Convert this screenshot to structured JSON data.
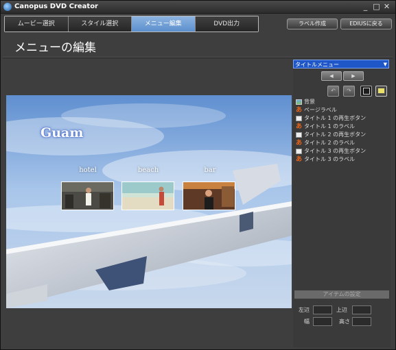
{
  "window": {
    "title": "Canopus DVD Creator",
    "controls": [
      "_",
      "□",
      "✕"
    ]
  },
  "steps": [
    "ムービー選択",
    "スタイル選択",
    "メニュー編集",
    "DVD出力"
  ],
  "active_step": 2,
  "toolbar": {
    "label_create": "ラベル作成",
    "back_to_edius": "EDIUSに戻る"
  },
  "page_title": "メニューの編集",
  "preview": {
    "menu_title": "Guam",
    "thumbnails": [
      {
        "label": "hotel"
      },
      {
        "label": "beach"
      },
      {
        "label": "bar"
      }
    ]
  },
  "panel": {
    "menu_select": "タイトルメニュー",
    "items": [
      {
        "icon": "background-icon",
        "label": "背景"
      },
      {
        "icon": "label-icon",
        "label": "ページラベル"
      },
      {
        "icon": "button-icon",
        "label": "タイトル 1 の再生ボタン"
      },
      {
        "icon": "label-icon",
        "label": "タイトル 1 のラベル"
      },
      {
        "icon": "button-icon",
        "label": "タイトル 2 の再生ボタン"
      },
      {
        "icon": "label-icon",
        "label": "タイトル 2 のラベル"
      },
      {
        "icon": "button-icon",
        "label": "タイトル 3 の再生ボタン"
      },
      {
        "icon": "label-icon",
        "label": "タイトル 3 のラベル"
      }
    ],
    "props_header": "アイテムの設定",
    "fields": {
      "left": "左辺",
      "top": "上辺",
      "width": "幅",
      "height": "高さ"
    }
  }
}
